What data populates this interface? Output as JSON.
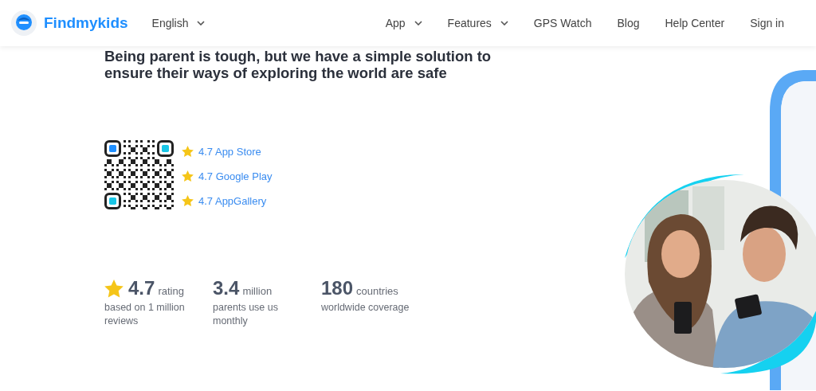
{
  "header": {
    "brand": "Findmykids",
    "language": "English",
    "nav": [
      {
        "label": "App",
        "dropdown": true
      },
      {
        "label": "Features",
        "dropdown": true
      },
      {
        "label": "GPS Watch",
        "dropdown": false
      },
      {
        "label": "Blog",
        "dropdown": false
      },
      {
        "label": "Help Center",
        "dropdown": false
      },
      {
        "label": "Sign in",
        "dropdown": false
      }
    ]
  },
  "hero": {
    "headline": [
      "Being parent is tough, but we have a simple solution to",
      "ensure their ways of exploring the world are safe"
    ],
    "ratings": [
      "4.7 App Store",
      "4.7 Google Play",
      "4.7 AppGallery"
    ],
    "stats": [
      {
        "value": "4.7",
        "unit": "rating",
        "description": "based on 1 million reviews",
        "star": true
      },
      {
        "value": "3.4",
        "unit": "million",
        "description": "parents use us monthly",
        "star": false
      },
      {
        "value": "180",
        "unit": "countries",
        "description": "worldwide coverage",
        "star": false
      }
    ],
    "photo": {
      "kind": "picture"
    }
  }
}
